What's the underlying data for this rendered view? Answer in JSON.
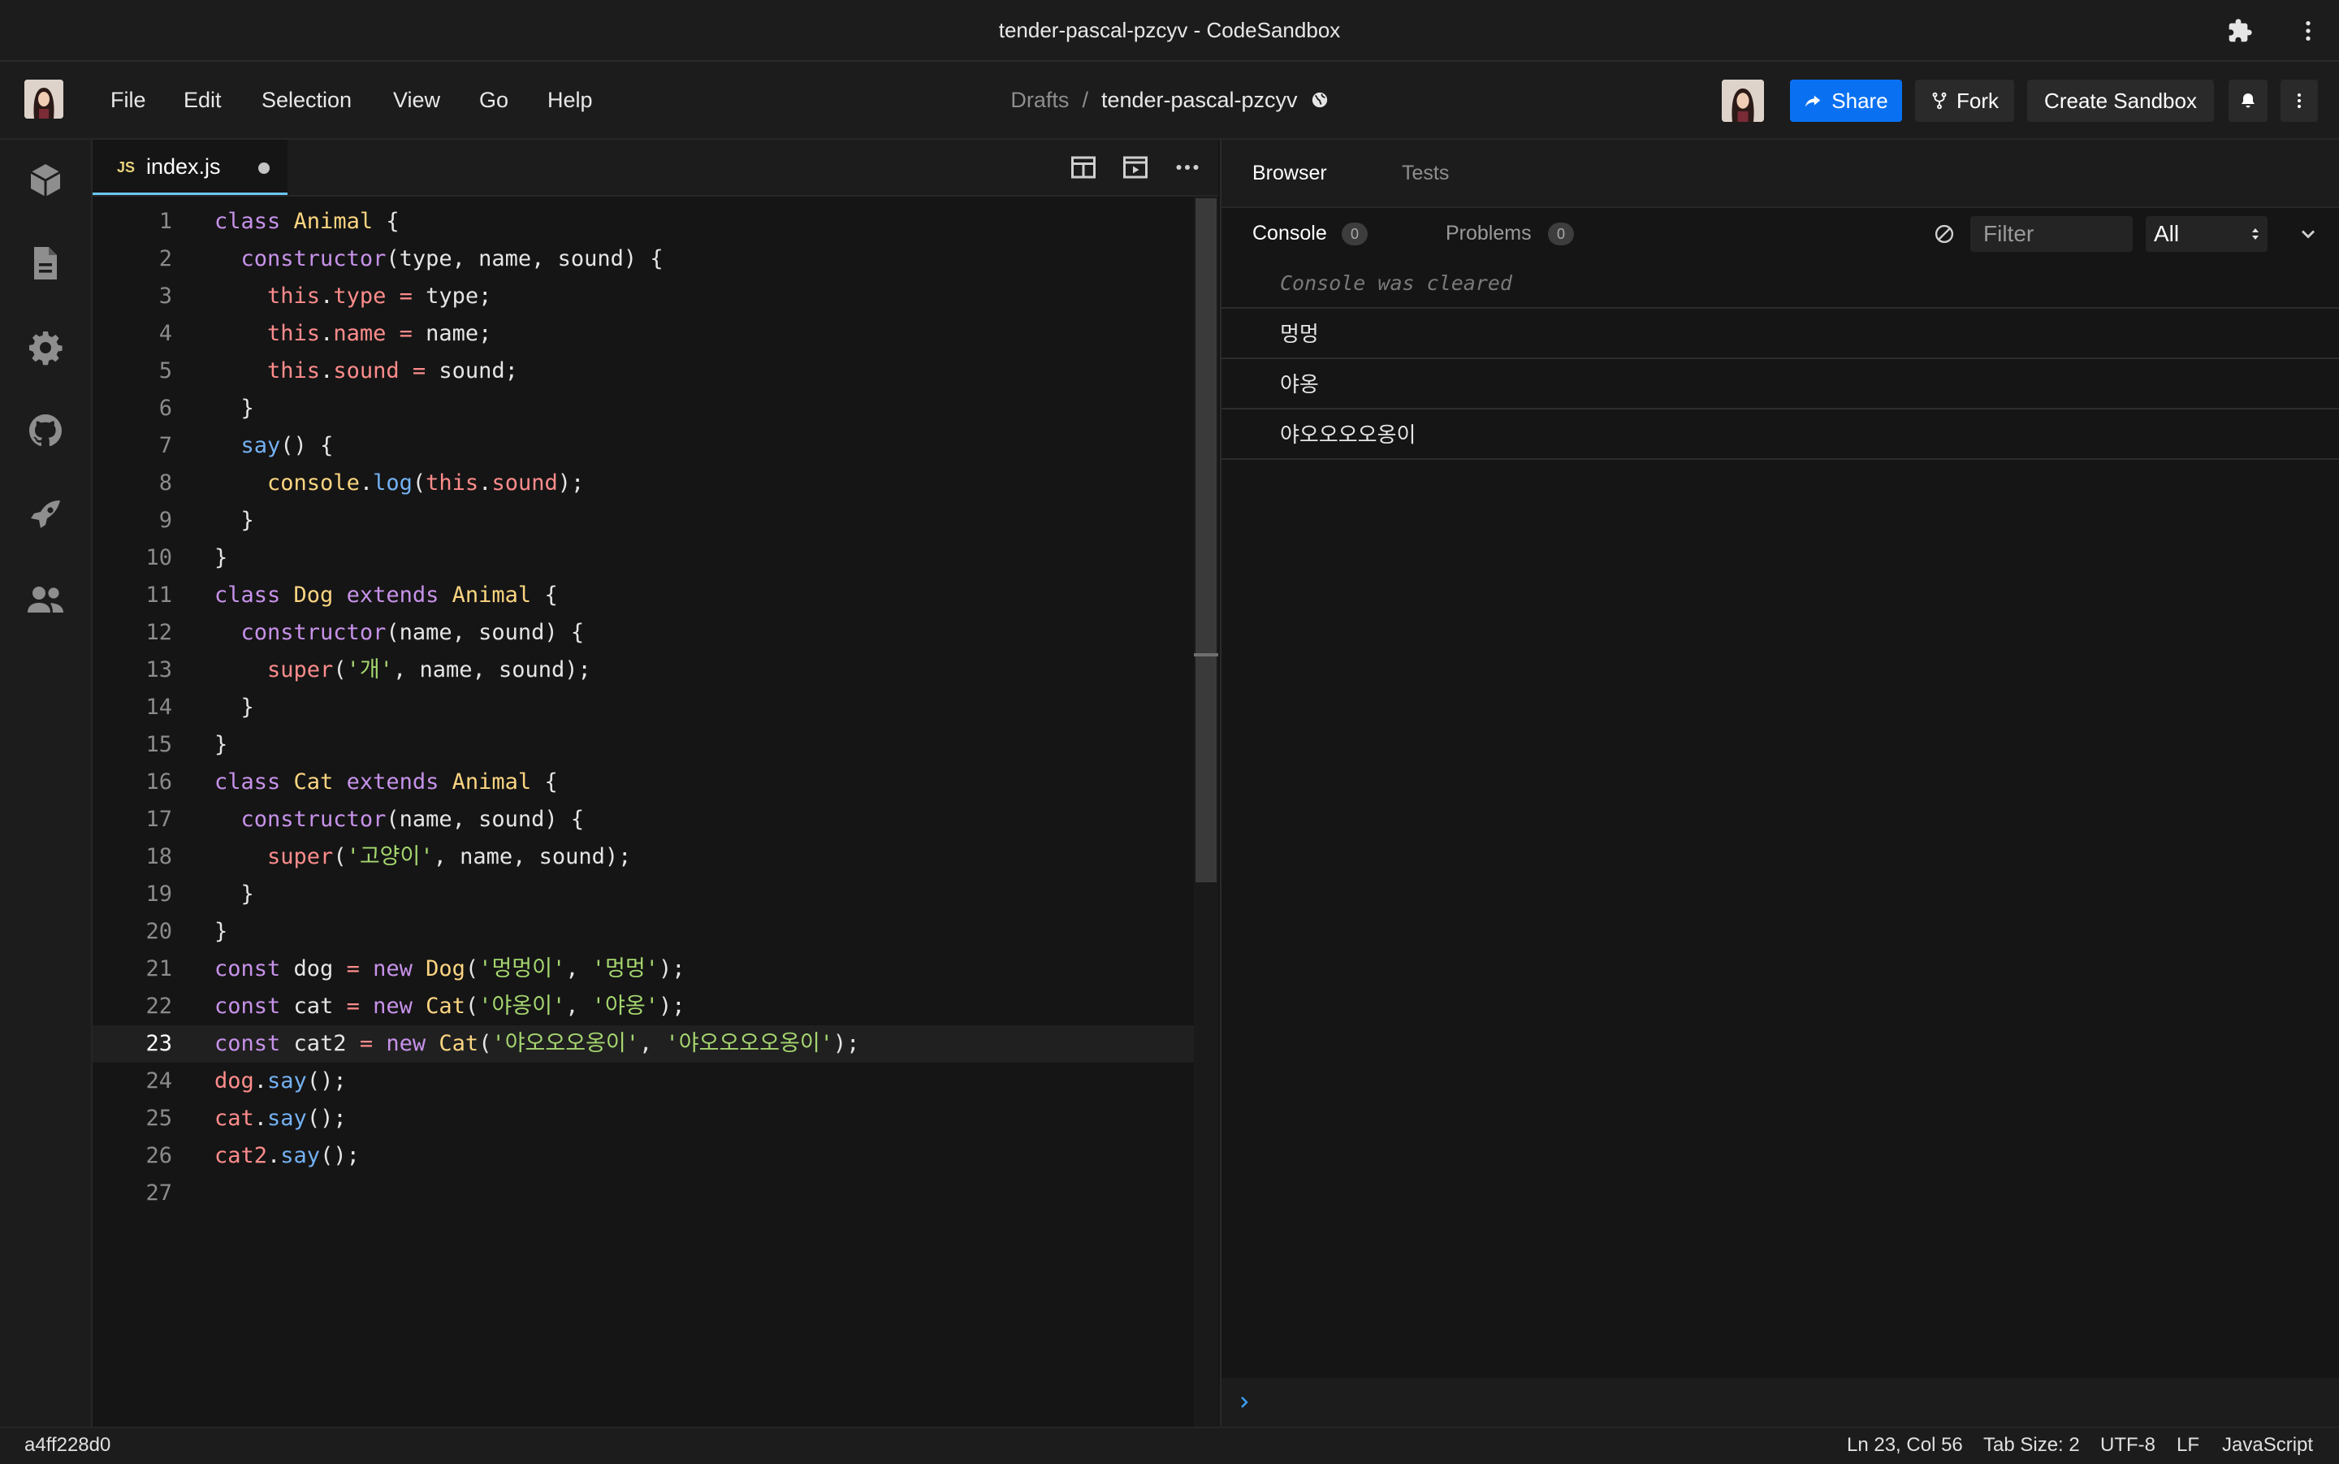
{
  "window": {
    "title": "tender-pascal-pzcyv - CodeSandbox"
  },
  "menu": {
    "items": [
      "File",
      "Edit",
      "Selection",
      "View",
      "Go",
      "Help"
    ]
  },
  "breadcrumb": {
    "parent": "Drafts",
    "separator": "/",
    "name": "tender-pascal-pzcyv"
  },
  "header_buttons": {
    "share": "Share",
    "fork": "Fork",
    "create": "Create Sandbox"
  },
  "editor": {
    "tab": {
      "badge": "JS",
      "label": "index.js"
    },
    "active_line": 23,
    "lines": [
      "class Animal {",
      "  constructor(type, name, sound) {",
      "    this.type = type;",
      "    this.name = name;",
      "    this.sound = sound;",
      "  }",
      "  say() {",
      "    console.log(this.sound);",
      "  }",
      "}",
      "class Dog extends Animal {",
      "  constructor(name, sound) {",
      "    super('개', name, sound);",
      "  }",
      "}",
      "class Cat extends Animal {",
      "  constructor(name, sound) {",
      "    super('고양이', name, sound);",
      "  }",
      "}",
      "const dog = new Dog('멍멍이', '멍멍');",
      "const cat = new Cat('야옹이', '야옹');",
      "const cat2 = new Cat('야오오오옹이', '야오오오오옹이');",
      "dog.say();",
      "cat.say();",
      "cat2.say();",
      ""
    ]
  },
  "panel": {
    "tabs": [
      "Browser",
      "Tests"
    ],
    "console_tab": "Console",
    "console_count": "0",
    "problems_tab": "Problems",
    "problems_count": "0",
    "filter_placeholder": "Filter",
    "level": "All",
    "cleared_message": "Console was cleared",
    "logs": [
      "멍멍",
      "야옹",
      "야오오오오옹이"
    ]
  },
  "status": {
    "commit": "a4ff228d0",
    "position": "Ln 23, Col 56",
    "tab_size": "Tab Size: 2",
    "encoding": "UTF-8",
    "eol": "LF",
    "language": "JavaScript"
  },
  "colors": {
    "accent": "#0971f1",
    "tab_underline": "#6cc7f6",
    "background": "#151515",
    "chrome": "#1c1c1c"
  },
  "icons": [
    "puzzle-icon",
    "kebab-icon",
    "globe-icon",
    "share-arrow-icon",
    "fork-icon",
    "bell-icon",
    "cube-icon",
    "file-icon",
    "gear-icon",
    "github-icon",
    "rocket-icon",
    "users-icon",
    "split-view-icon",
    "preview-icon",
    "more-icon",
    "clear-icon",
    "chevron-down-icon",
    "prompt-chevron-icon"
  ]
}
